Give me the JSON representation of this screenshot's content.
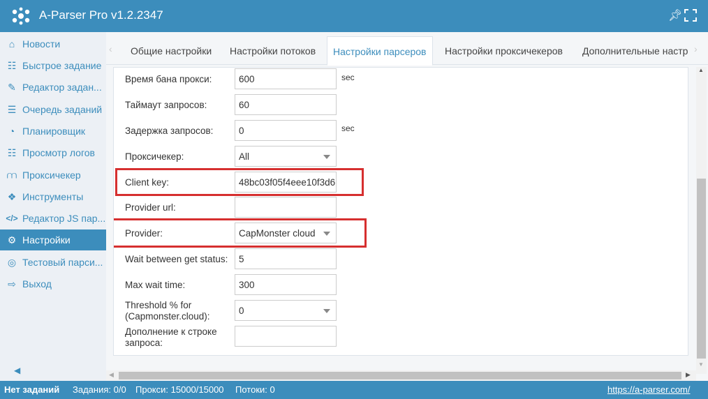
{
  "app": {
    "title": "A-Parser Pro v1.2.2347",
    "pin_icon": "pin-icon",
    "fullscreen_icon": "fullscreen-icon"
  },
  "sidebar": {
    "items": [
      {
        "label": "Новости",
        "icon": "home-icon"
      },
      {
        "label": "Быстрое задание",
        "icon": "sitemap-icon"
      },
      {
        "label": "Редактор задан...",
        "icon": "pencil-icon"
      },
      {
        "label": "Очередь заданий",
        "icon": "list-icon"
      },
      {
        "label": "Планировщик",
        "icon": "clock-icon"
      },
      {
        "label": "Просмотр логов",
        "icon": "file-icon"
      },
      {
        "label": "Проксичекер",
        "icon": "network-icon"
      },
      {
        "label": "Инструменты",
        "icon": "cubes-icon"
      },
      {
        "label": "Редактор JS пар...",
        "icon": "code-icon"
      },
      {
        "label": "Настройки",
        "icon": "gears-icon",
        "active": true
      },
      {
        "label": "Тестовый парси...",
        "icon": "target-icon"
      },
      {
        "label": "Выход",
        "icon": "sign-out-icon"
      }
    ],
    "collapse_icon": "caret-left-icon"
  },
  "tabs": [
    {
      "label": "Общие настройки"
    },
    {
      "label": "Настройки потоков"
    },
    {
      "label": "Настройки парсеров",
      "active": true
    },
    {
      "label": "Настройки проксичекеров"
    },
    {
      "label": "Дополнительные настр"
    }
  ],
  "form": {
    "ban_time": {
      "label": "Время бана прокси:",
      "value": "600",
      "unit": "sec"
    },
    "timeout": {
      "label": "Таймаут запросов:",
      "value": "60"
    },
    "delay": {
      "label": "Задержка запросов:",
      "value": "0",
      "unit": "sec"
    },
    "proxychecker": {
      "label": "Проксичекер:",
      "value": "All"
    },
    "client_key": {
      "label": "Client key:",
      "value": "48bc03f05f4eee10f3d6"
    },
    "provider_url": {
      "label": "Provider url:",
      "value": ""
    },
    "provider": {
      "label": "Provider:",
      "value": "CapMonster cloud"
    },
    "wait_between": {
      "label": "Wait between get status:",
      "value": "5"
    },
    "max_wait": {
      "label": "Max wait time:",
      "value": "300"
    },
    "threshold": {
      "label_line1": "Threshold % for",
      "label_line2": "(Capmonster.cloud):",
      "value": "0"
    },
    "query_suffix": {
      "label_line1": "Дополнение к строке",
      "label_line2": "запроса:",
      "value": ""
    }
  },
  "status": {
    "no_tasks": "Нет заданий",
    "tasks": "Задания: 0/0",
    "proxies": "Прокси: 15000/15000",
    "threads": "Потоки: 0",
    "link": "https://a-parser.com/"
  },
  "colors": {
    "brand": "#3c8dbc",
    "highlight": "#d62f2f",
    "sidebar_bg": "#ecf0f5"
  }
}
